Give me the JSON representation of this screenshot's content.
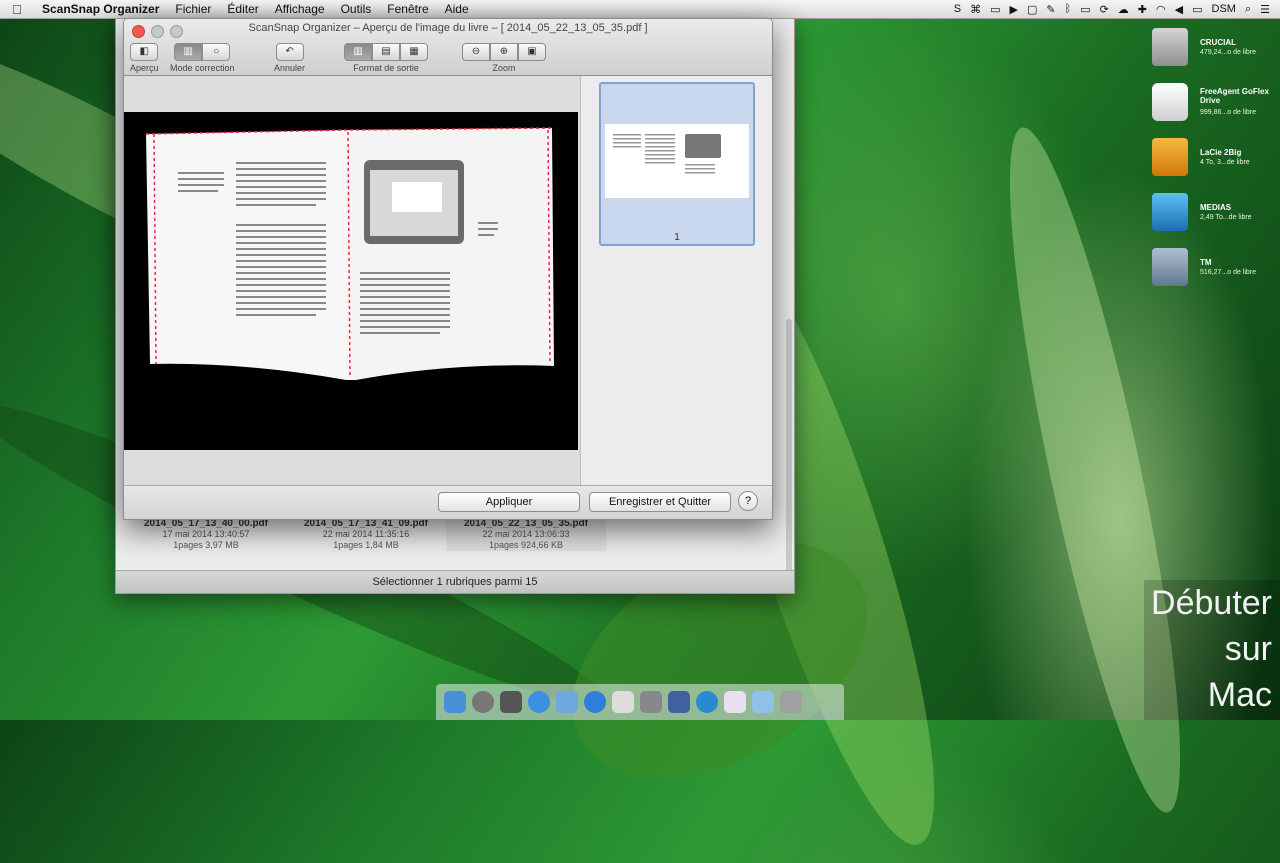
{
  "menubar": {
    "apple": "",
    "items": [
      "ScanSnap Organizer",
      "Fichier",
      "Éditer",
      "Affichage",
      "Outils",
      "Fenêtre",
      "Aide"
    ],
    "status": {
      "user": "DSM"
    }
  },
  "background_window": {
    "status_text": "Sélectionner 1 rubriques parmi 15",
    "files": [
      {
        "name": "2014_05_17_13_40_00.pdf",
        "date": "17 mai 2014 13:40:57",
        "info": "1pages  3,97 MB"
      },
      {
        "name": "2014_05_17_13_41_09.pdf",
        "date": "22 mai 2014 11:35:16",
        "info": "1pages  1,84 MB"
      },
      {
        "name": "2014_05_22_13_05_35.pdf",
        "date": "22 mai 2014 13:06:33",
        "info": "1pages  924,66 KB"
      }
    ]
  },
  "preview_window": {
    "title": "ScanSnap Organizer – Aperçu de l'image du livre – [ 2014_05_22_13_05_35.pdf ]",
    "toolbar": {
      "apercu": "Aperçu",
      "mode_correction": "Mode correction",
      "annuler": "Annuler",
      "format_sortie": "Format de sortie",
      "zoom": "Zoom"
    },
    "thumbnail_number": "1",
    "buttons": {
      "apply": "Appliquer",
      "save_quit": "Enregistrer et Quitter",
      "help": "?"
    }
  },
  "drives": [
    {
      "name": "CRUCIAL",
      "info": "479,24...o de libre",
      "color": "#b9b9b9"
    },
    {
      "name": "FreeAgent GoFlex Drive",
      "info": "999,86...o de libre",
      "color": "#e6e6e6"
    },
    {
      "name": "LaCie 2Big",
      "info": "4 To, 3...de libre",
      "color": "#f0a020"
    },
    {
      "name": "MEDIAS",
      "info": "2,49 To...de libre",
      "color": "#3aa0e0"
    },
    {
      "name": "TM",
      "info": "516,27...o de libre",
      "color": "#8aa0b8"
    }
  ],
  "watermark": [
    "Débuter",
    "sur",
    "Mac"
  ]
}
